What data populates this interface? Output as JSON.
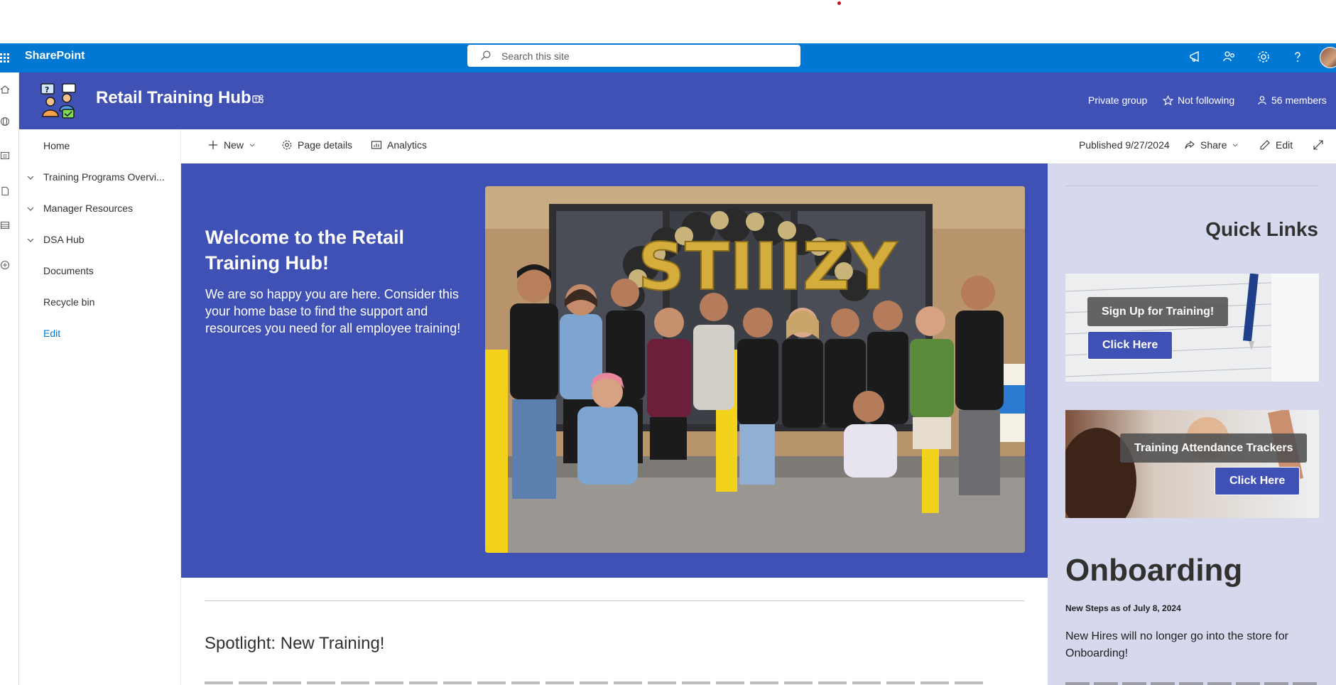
{
  "suitebar": {
    "app_name": "SharePoint",
    "search_placeholder": "Search this site"
  },
  "site": {
    "title": "Retail Training Hub",
    "privacy": "Private group",
    "follow": "Not following",
    "members": "56 members"
  },
  "nav": {
    "items": [
      {
        "label": "Home",
        "expandable": false
      },
      {
        "label": "Training Programs Overvi...",
        "expandable": true
      },
      {
        "label": "Manager Resources",
        "expandable": true
      },
      {
        "label": "DSA Hub",
        "expandable": true
      },
      {
        "label": "Documents",
        "expandable": false
      },
      {
        "label": "Recycle bin",
        "expandable": false
      }
    ],
    "edit": "Edit"
  },
  "commandbar": {
    "new": "New",
    "page_details": "Page details",
    "analytics": "Analytics",
    "published": "Published 9/27/2024",
    "share": "Share",
    "edit": "Edit"
  },
  "hero": {
    "title": "Welcome to the Retail Training Hub!",
    "body": "We are so happy you are here. Consider this your home base to find the support and resources you need for all employee training!",
    "photo": {
      "balloon_text": "STIIIZY"
    }
  },
  "main": {
    "spotlight_title": "Spotlight: New Training!"
  },
  "quick_links": {
    "title": "Quick Links",
    "cards": [
      {
        "label": "Sign Up for Training!",
        "button": "Click Here"
      },
      {
        "label": "Training Attendance Trackers",
        "button": "Click Here"
      }
    ]
  },
  "onboarding": {
    "title": "Onboarding",
    "subtitle": "New Steps as of July 8, 2024",
    "body": "New Hires will no longer go into the store for Onboarding!"
  },
  "colors": {
    "suitebar": "#0078d4",
    "brand_header": "#4051b5",
    "right_panel": "#d6d9ee",
    "link": "#0078d4"
  }
}
